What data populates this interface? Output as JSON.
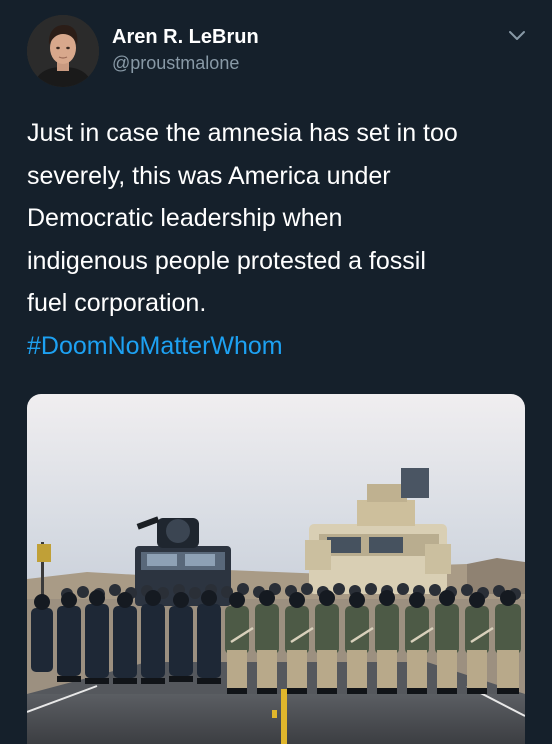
{
  "tweet": {
    "author_name": "Aren R. LeBrun",
    "author_handle": "@proustmalone",
    "text_lines": [
      "Just in case the amnesia has set in too",
      "severely, this was America under",
      "Democratic leadership when",
      "indigenous people protested a fossil",
      "fuel corporation."
    ],
    "hashtag": "#DoomNoMatterWhom",
    "avatar_icon": "profile-photo",
    "menu_icon": "chevron-down-icon",
    "media_description_icon": "photo"
  },
  "colors": {
    "background": "#15202b",
    "text": "#ffffff",
    "secondary_text": "#8899a6",
    "link": "#1da1f2"
  }
}
